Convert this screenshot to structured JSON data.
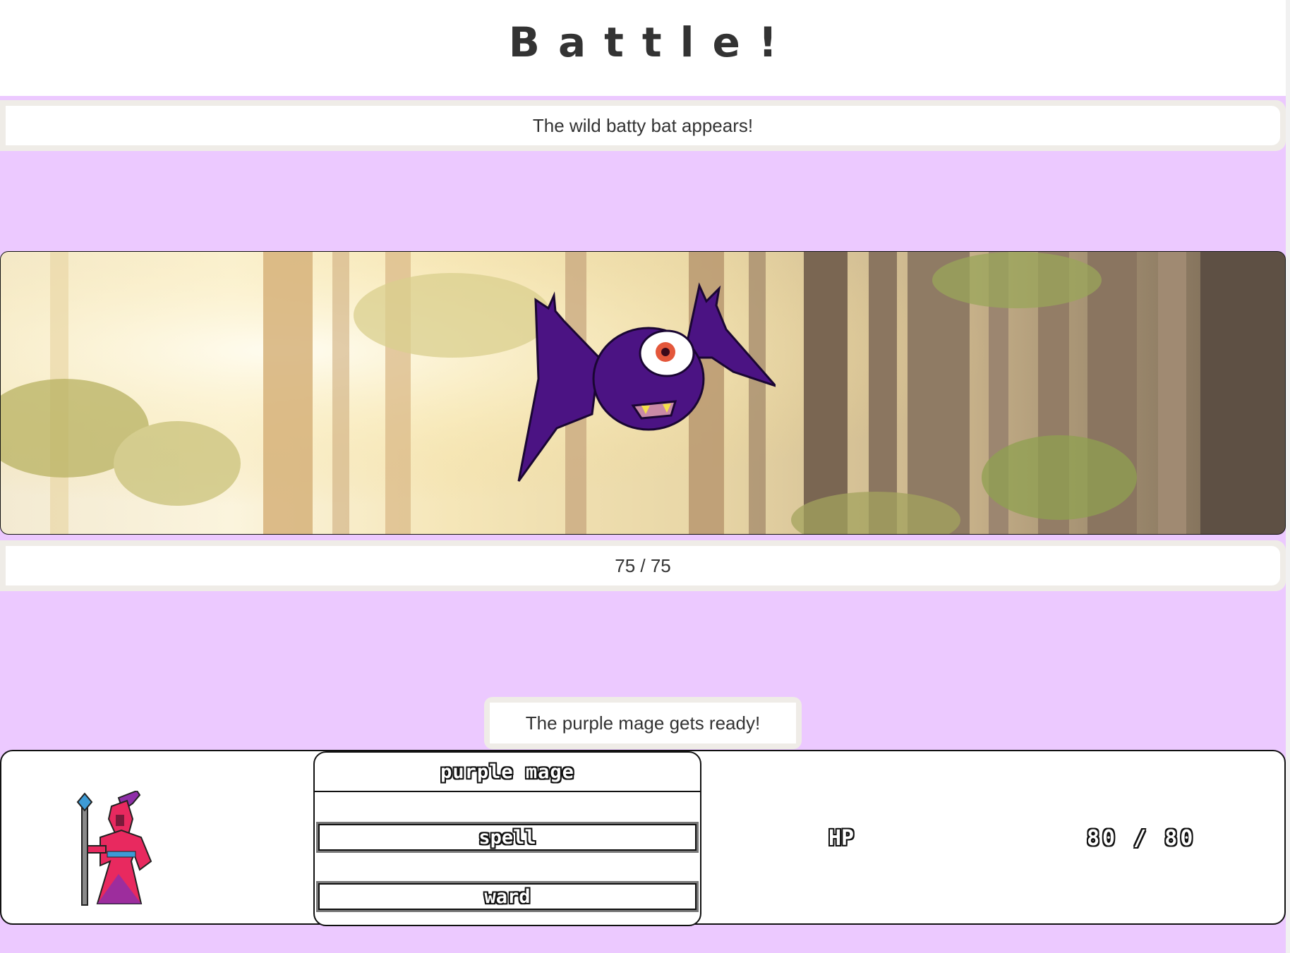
{
  "title": "Battle!",
  "enemy": {
    "message": "The wild batty bat appears!",
    "hp_text": "75 / 75",
    "hp_current": 75,
    "hp_max": 75
  },
  "player": {
    "message": "The purple mage gets ready!",
    "name": "purple mage",
    "actions": [
      "spell",
      "ward"
    ],
    "hp_label": "HP",
    "hp_text": "80 / 80",
    "hp_current": 80,
    "hp_max": 80
  },
  "colors": {
    "arena_bg": "#ecc9ff",
    "bat_body": "#4b1383",
    "mage_robe": "#e8295f"
  },
  "icons": {
    "enemy_sprite": "bat-sprite-icon",
    "player_sprite": "mage-sprite-icon"
  }
}
